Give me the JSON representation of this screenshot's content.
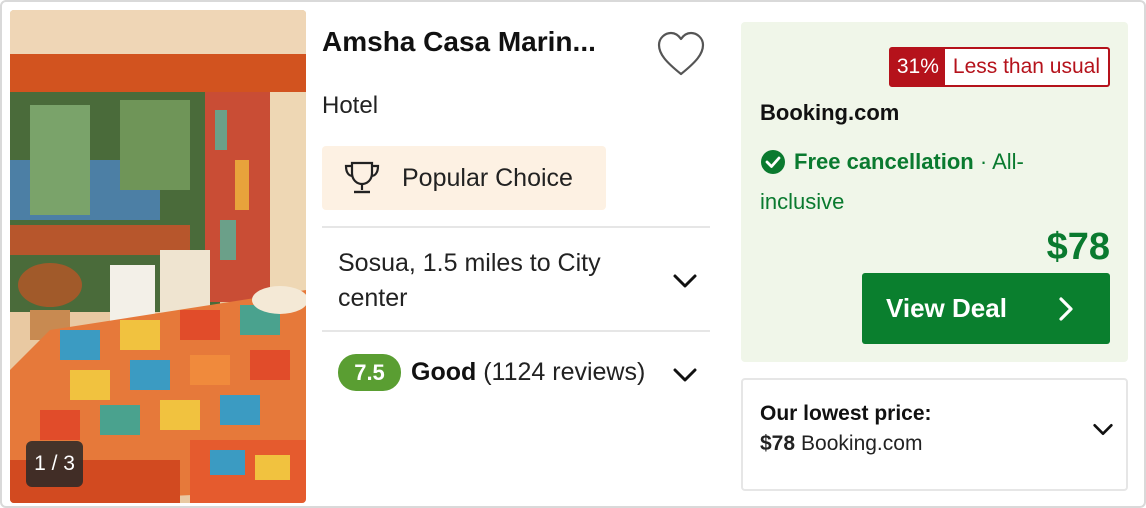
{
  "photo": {
    "counter": "1 / 3"
  },
  "hotel": {
    "name": "Amsha Casa Marin...",
    "type": "Hotel",
    "badge": "Popular Choice",
    "location": "Sosua, 1.5 miles to City center",
    "rating": {
      "score": "7.5",
      "label": "Good",
      "reviews": "(1124 reviews)"
    }
  },
  "deal": {
    "discount_pct": "31%",
    "discount_text": "Less than usual",
    "provider": "Booking.com",
    "cancellation": "Free cancellation",
    "separator": "·",
    "board": "All-inclusive",
    "price": "$78",
    "button": "View Deal"
  },
  "lowest": {
    "title": "Our lowest price:",
    "price": "$78",
    "provider": "Booking.com"
  },
  "colors": {
    "accent_green": "#0a7f2e",
    "score_green": "#5a9e32",
    "discount_red": "#b5121b",
    "deal_bg": "#f0f6e9",
    "badge_bg": "#fdf1e3"
  },
  "icons": [
    "heart-icon",
    "trophy-icon",
    "chevron-down-icon",
    "check-circle-icon",
    "chevron-right-icon"
  ]
}
